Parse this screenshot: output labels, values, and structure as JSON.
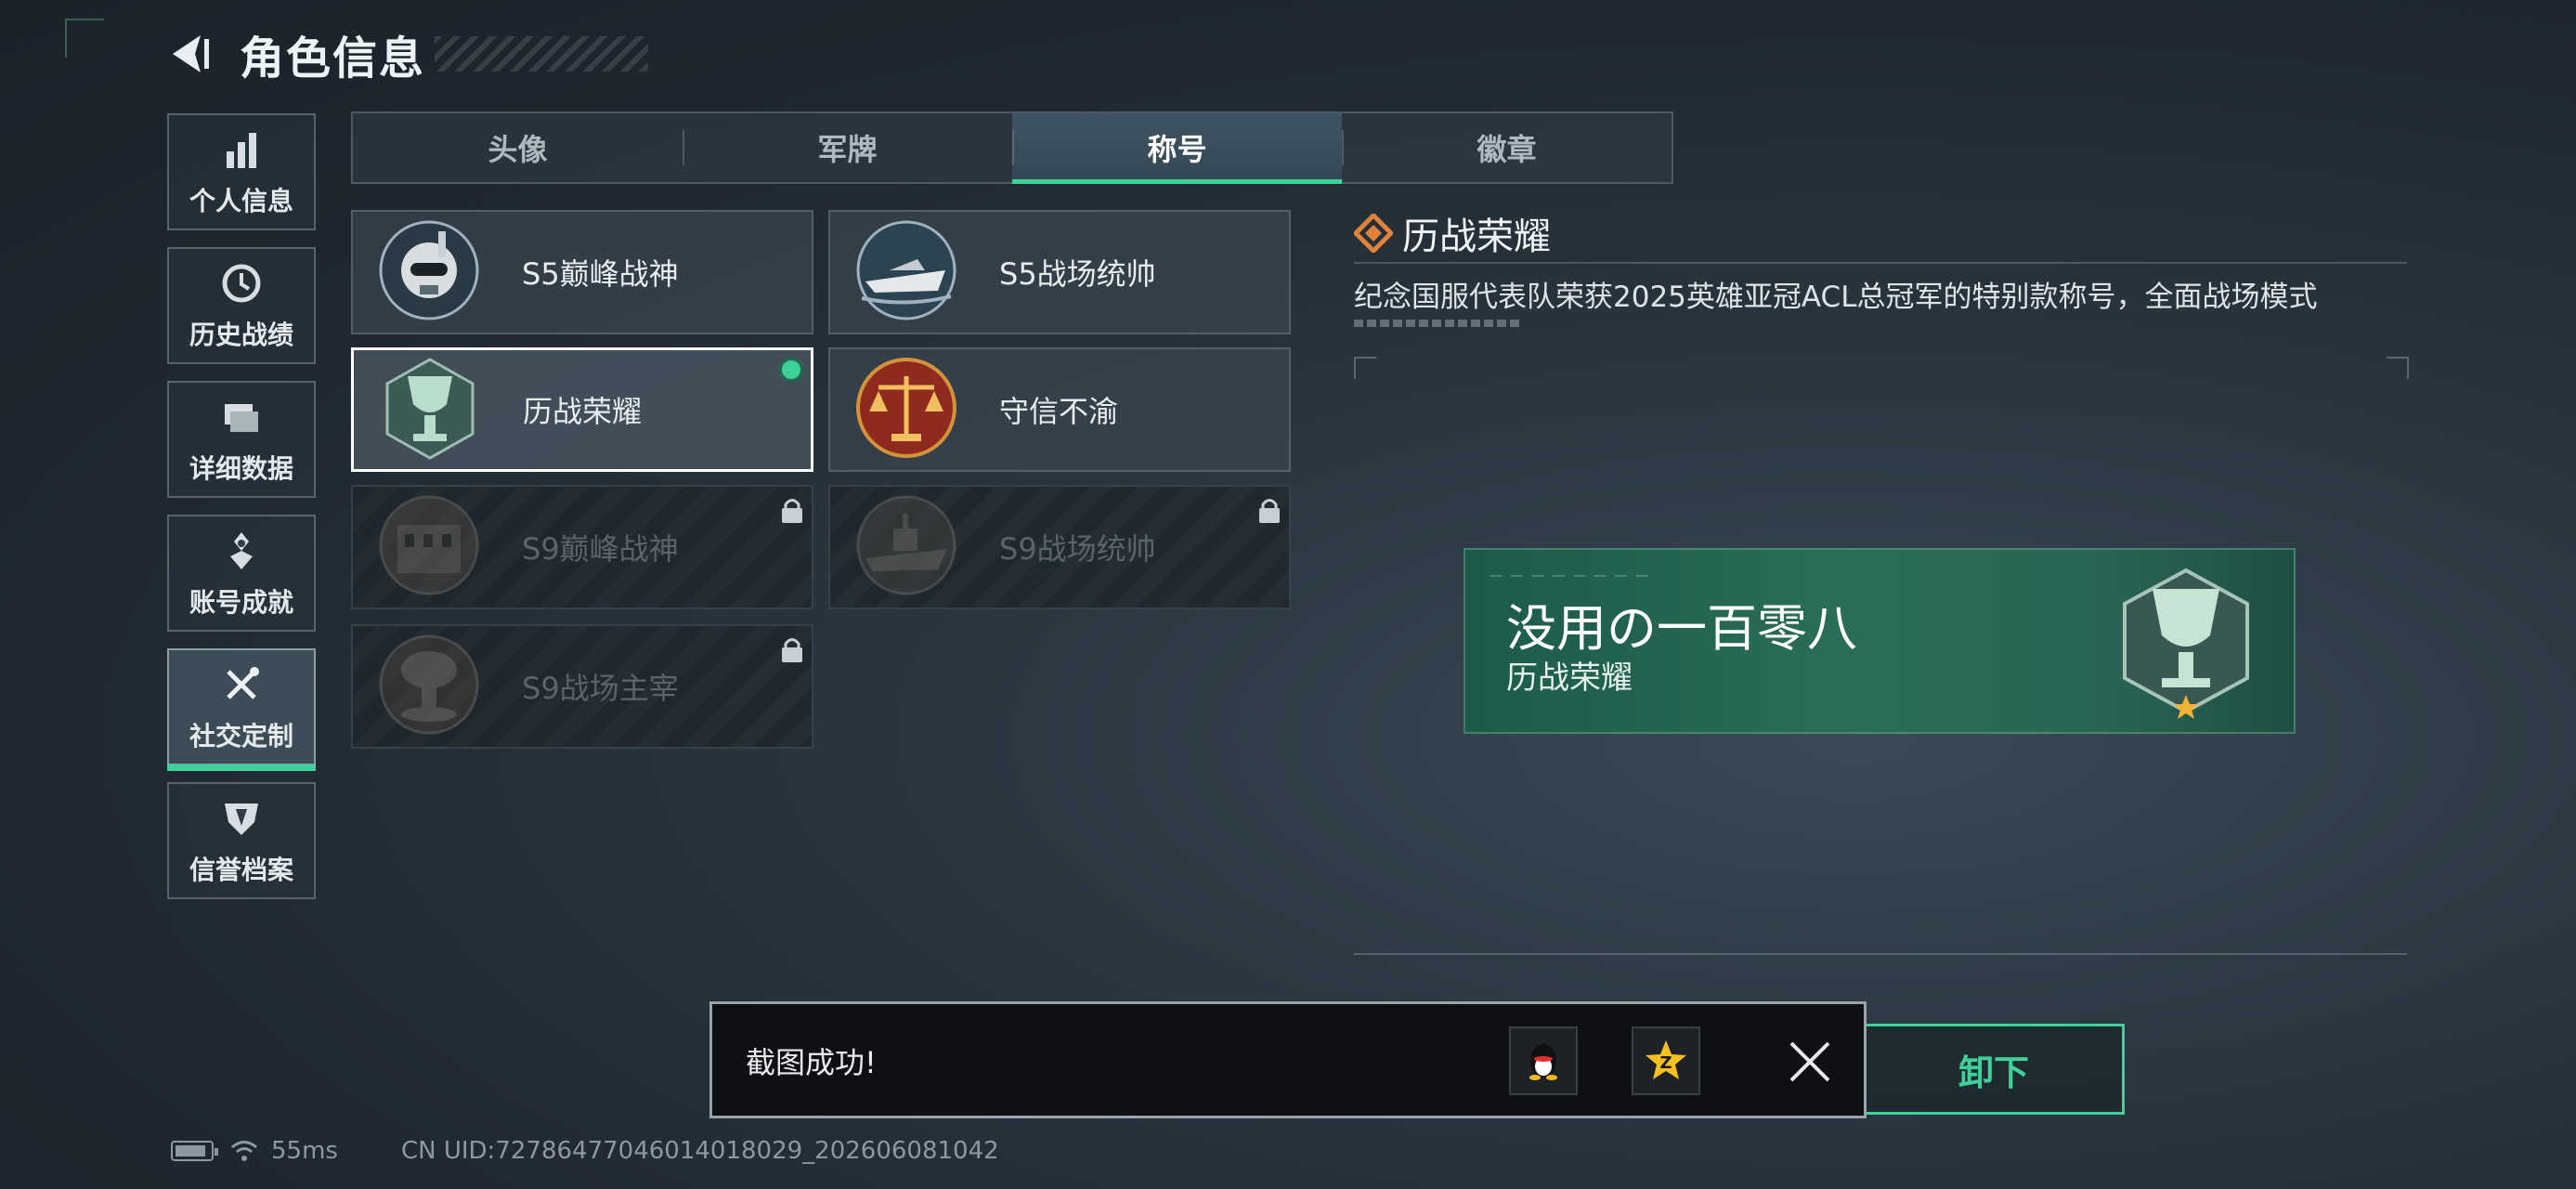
{
  "header": {
    "title": "角色信息",
    "back_icon": "back-arrow-icon"
  },
  "sidebar": {
    "items": [
      {
        "label": "个人信息",
        "icon": "bar-chart-icon",
        "glyph": "▐▌"
      },
      {
        "label": "历史战绩",
        "icon": "clock-icon",
        "glyph": "◷"
      },
      {
        "label": "详细数据",
        "icon": "folder-icon",
        "glyph": "▤"
      },
      {
        "label": "账号成就",
        "icon": "achievement-icon",
        "glyph": "✥"
      },
      {
        "label": "社交定制",
        "icon": "tools-icon",
        "glyph": "✂",
        "active": true
      },
      {
        "label": "信誉档案",
        "icon": "credit-shield-icon",
        "glyph": "⛉"
      }
    ]
  },
  "tabs": [
    {
      "label": "头像"
    },
    {
      "label": "军牌"
    },
    {
      "label": "称号",
      "active": true
    },
    {
      "label": "徽章"
    }
  ],
  "titles": [
    {
      "label": "S5巅峰战神",
      "icon": "skull-diver-badge-icon",
      "state": "normal"
    },
    {
      "label": "S5战场统帅",
      "icon": "speedboat-badge-icon",
      "state": "normal"
    },
    {
      "label": "历战荣耀",
      "icon": "trophy-badge-icon",
      "state": "selected"
    },
    {
      "label": "守信不渝",
      "icon": "scales-badge-icon",
      "state": "normal"
    },
    {
      "label": "S9巅峰战神",
      "icon": "building-badge-icon",
      "state": "locked"
    },
    {
      "label": "S9战场统帅",
      "icon": "warship-badge-icon",
      "state": "locked"
    },
    {
      "label": "S9战场主宰",
      "icon": "mushroom-cloud-badge-icon",
      "state": "locked"
    }
  ],
  "detail": {
    "title": "历战荣耀",
    "description": "纪念国服代表队荣获2025英雄亚冠ACL总冠军的特别款称号，全面战场模式 "
  },
  "nameplate": {
    "player_name": "没用の一百零八",
    "title": "历战荣耀"
  },
  "unequip_label": "卸下",
  "toast": {
    "message": "截图成功!"
  },
  "status": {
    "ping": "55ms",
    "uid": "CN UID:7278647704601401​8029_202606081042"
  },
  "colors": {
    "accent": "#3fd19a",
    "lock": "#c9d0d5",
    "badge_gold": "#f2b233"
  }
}
